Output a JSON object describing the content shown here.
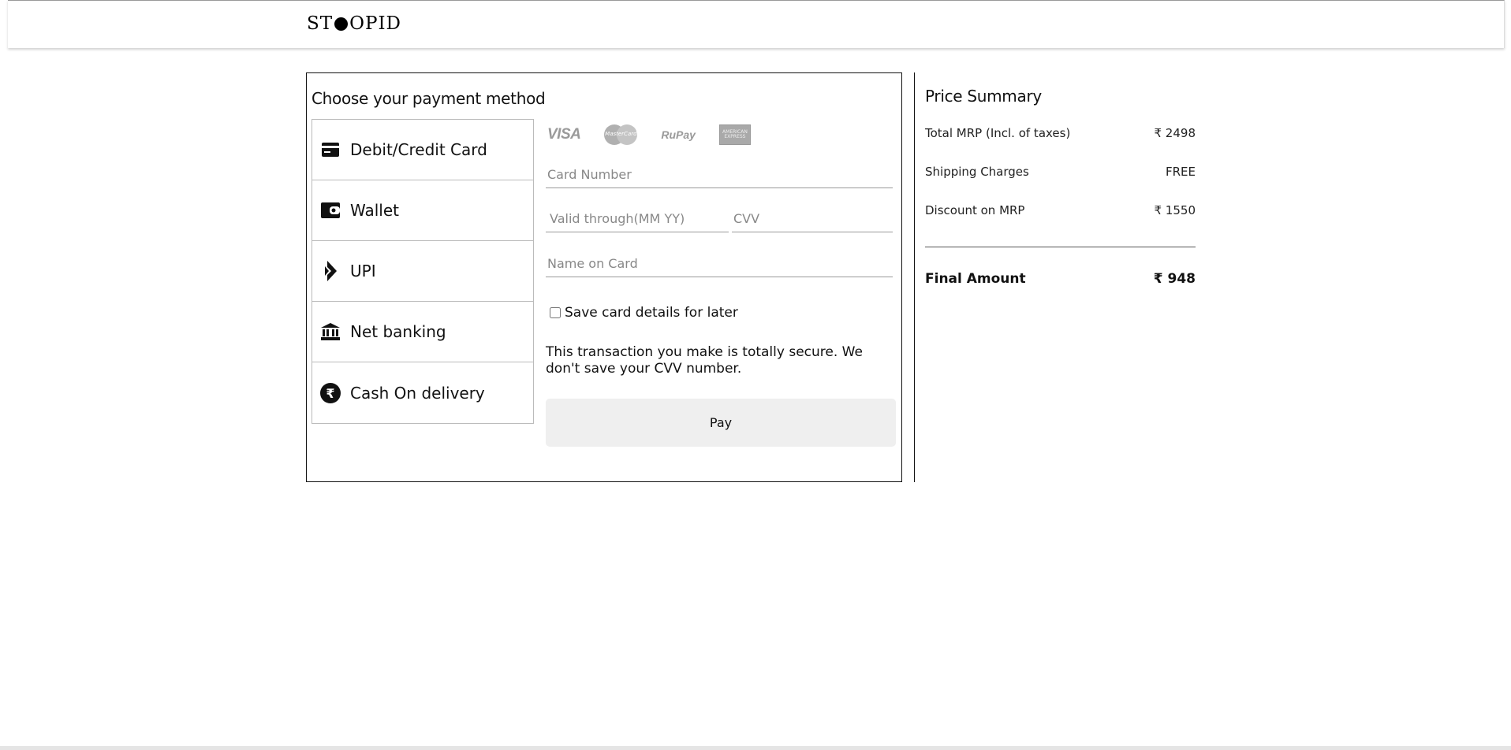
{
  "header": {
    "logo_left": "ST",
    "logo_right": "OPID"
  },
  "payment": {
    "title": "Choose your payment method",
    "methods": [
      {
        "label": "Debit/Credit Card",
        "icon": "card-icon"
      },
      {
        "label": "Wallet",
        "icon": "wallet-icon"
      },
      {
        "label": "UPI",
        "icon": "upi-icon"
      },
      {
        "label": "Net banking",
        "icon": "bank-icon"
      },
      {
        "label": "Cash On delivery",
        "icon": "rupee-icon"
      }
    ],
    "brands": {
      "visa": "VISA",
      "mastercard": "MasterCard",
      "rupay": "RuPay",
      "amex": "AMERICAN EXPRESS"
    },
    "card_number_placeholder": "Card Number",
    "valid_through_placeholder": "Valid through(MM YY)",
    "cvv_placeholder": "CVV",
    "name_placeholder": "Name on Card",
    "save_label": "Save card details for later",
    "secure_note": "This transaction you make is totally secure. We don't save your CVV number.",
    "pay_label": "Pay"
  },
  "summary": {
    "title": "Price Summary",
    "rows": [
      {
        "label": "Total MRP (Incl. of taxes)",
        "value": "₹ 2498"
      },
      {
        "label": "Shipping Charges",
        "value": "FREE"
      },
      {
        "label": "Discount on MRP",
        "value": "₹ 1550"
      }
    ],
    "final_label": "Final Amount",
    "final_value": "₹ 948"
  }
}
